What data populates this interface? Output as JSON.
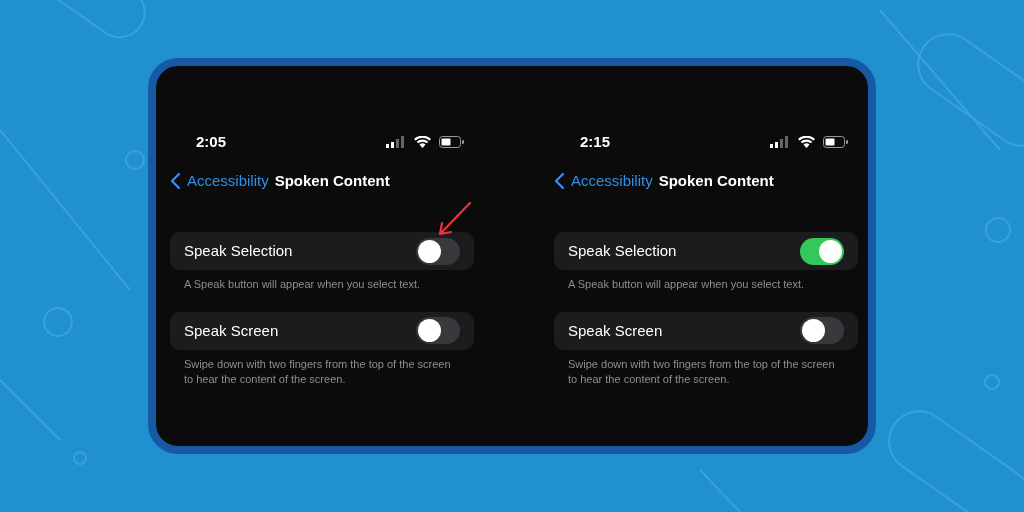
{
  "screens": [
    {
      "time": "2:05",
      "nav": {
        "back": "Accessibility",
        "title": "Spoken Content"
      },
      "settings": [
        {
          "label": "Speak Selection",
          "on": false,
          "arrow": true,
          "footer": "A Speak button will appear when you select text."
        },
        {
          "label": "Speak Screen",
          "on": false,
          "arrow": false,
          "footer": "Swipe down with two fingers from the top of the screen to hear the content of the screen."
        }
      ]
    },
    {
      "time": "2:15",
      "nav": {
        "back": "Accessibility",
        "title": "Spoken Content"
      },
      "settings": [
        {
          "label": "Speak Selection",
          "on": true,
          "arrow": false,
          "footer": "A Speak button will appear when you select text."
        },
        {
          "label": "Speak Screen",
          "on": false,
          "arrow": false,
          "footer": "Swipe down with two fingers from the top of the screen to hear the content of the screen."
        }
      ]
    }
  ]
}
